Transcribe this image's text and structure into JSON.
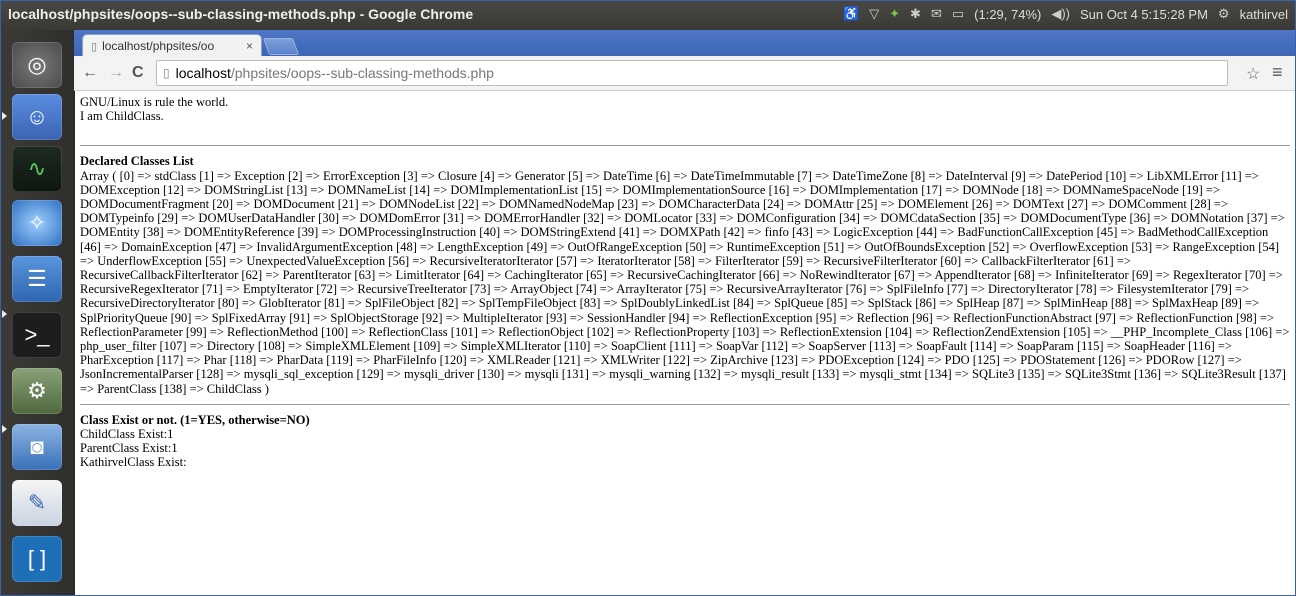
{
  "window": {
    "title": "localhost/phpsites/oops--sub-classing-methods.php - Google Chrome"
  },
  "indicators": {
    "battery": "(1:29, 74%)",
    "datetime": "Sun Oct 4 5:15:28 PM",
    "user": "kathirvel"
  },
  "tab": {
    "label": "localhost/phpsites/oo",
    "close": "×"
  },
  "address": {
    "host": "localhost",
    "path": "/phpsites/oops--sub-classing-methods.php"
  },
  "page": {
    "line1": "GNU/Linux is rule the world.",
    "line2": "I am ChildClass.",
    "declared_heading": "Declared Classes List",
    "declared_classes": "Array ( [0] => stdClass [1] => Exception [2] => ErrorException [3] => Closure [4] => Generator [5] => DateTime [6] => DateTimeImmutable [7] => DateTimeZone [8] => DateInterval [9] => DatePeriod [10] => LibXMLError [11] => DOMException [12] => DOMStringList [13] => DOMNameList [14] => DOMImplementationList [15] => DOMImplementationSource [16] => DOMImplementation [17] => DOMNode [18] => DOMNameSpaceNode [19] => DOMDocumentFragment [20] => DOMDocument [21] => DOMNodeList [22] => DOMNamedNodeMap [23] => DOMCharacterData [24] => DOMAttr [25] => DOMElement [26] => DOMText [27] => DOMComment [28] => DOMTypeinfo [29] => DOMUserDataHandler [30] => DOMDomError [31] => DOMErrorHandler [32] => DOMLocator [33] => DOMConfiguration [34] => DOMCdataSection [35] => DOMDocumentType [36] => DOMNotation [37] => DOMEntity [38] => DOMEntityReference [39] => DOMProcessingInstruction [40] => DOMStringExtend [41] => DOMXPath [42] => finfo [43] => LogicException [44] => BadFunctionCallException [45] => BadMethodCallException [46] => DomainException [47] => InvalidArgumentException [48] => LengthException [49] => OutOfRangeException [50] => RuntimeException [51] => OutOfBoundsException [52] => OverflowException [53] => RangeException [54] => UnderflowException [55] => UnexpectedValueException [56] => RecursiveIteratorIterator [57] => IteratorIterator [58] => FilterIterator [59] => RecursiveFilterIterator [60] => CallbackFilterIterator [61] => RecursiveCallbackFilterIterator [62] => ParentIterator [63] => LimitIterator [64] => CachingIterator [65] => RecursiveCachingIterator [66] => NoRewindIterator [67] => AppendIterator [68] => InfiniteIterator [69] => RegexIterator [70] => RecursiveRegexIterator [71] => EmptyIterator [72] => RecursiveTreeIterator [73] => ArrayObject [74] => ArrayIterator [75] => RecursiveArrayIterator [76] => SplFileInfo [77] => DirectoryIterator [78] => FilesystemIterator [79] => RecursiveDirectoryIterator [80] => GlobIterator [81] => SplFileObject [82] => SplTempFileObject [83] => SplDoublyLinkedList [84] => SplQueue [85] => SplStack [86] => SplHeap [87] => SplMinHeap [88] => SplMaxHeap [89] => SplPriorityQueue [90] => SplFixedArray [91] => SplObjectStorage [92] => MultipleIterator [93] => SessionHandler [94] => ReflectionException [95] => Reflection [96] => ReflectionFunctionAbstract [97] => ReflectionFunction [98] => ReflectionParameter [99] => ReflectionMethod [100] => ReflectionClass [101] => ReflectionObject [102] => ReflectionProperty [103] => ReflectionExtension [104] => ReflectionZendExtension [105] => __PHP_Incomplete_Class [106] => php_user_filter [107] => Directory [108] => SimpleXMLElement [109] => SimpleXMLIterator [110] => SoapClient [111] => SoapVar [112] => SoapServer [113] => SoapFault [114] => SoapParam [115] => SoapHeader [116] => PharException [117] => Phar [118] => PharData [119] => PharFileInfo [120] => XMLReader [121] => XMLWriter [122] => ZipArchive [123] => PDOException [124] => PDO [125] => PDOStatement [126] => PDORow [127] => JsonIncrementalParser [128] => mysqli_sql_exception [129] => mysqli_driver [130] => mysqli [131] => mysqli_warning [132] => mysqli_result [133] => mysqli_stmt [134] => SQLite3 [135] => SQLite3Stmt [136] => SQLite3Result [137] => ParentClass [138] => ChildClass )",
    "exist_heading": "Class Exist or not. (1=YES, otherwise=NO)",
    "exist_child": "ChildClass Exist:1",
    "exist_parent": "ParentClass Exist:1",
    "exist_kathirvel": "KathirvelClass Exist:"
  },
  "colors": {
    "tabstrip": "#4a72c0",
    "panel": "#3c3b37",
    "launcher": "#2f2e2b"
  }
}
